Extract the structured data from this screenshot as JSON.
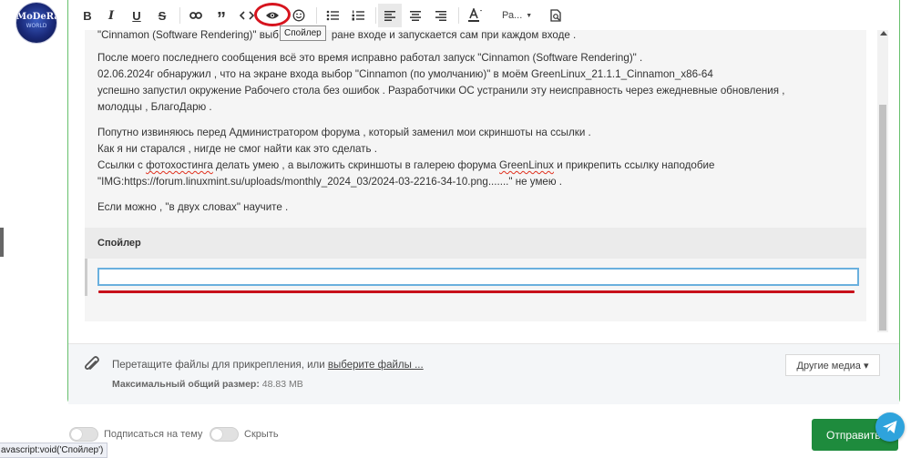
{
  "avatar": {
    "logo_text": "MoDeRa",
    "logo_sub": "WORLD"
  },
  "toolbar": {
    "bold": "B",
    "italic": "I",
    "underline": "U",
    "strike": "S",
    "quote": "”",
    "font_label": "Ра..."
  },
  "tooltip": {
    "spoiler": "Спойлер"
  },
  "post": {
    "lines": [
      [
        "\"Cinnamon (Software Rendering)\" выб",
        "ране входе и запускается сам при каждом входе ."
      ],
      [
        "После моего последнего сообщения всё это время исправно работал запуск \"Cinnamon (Software Rendering)\" ."
      ],
      [
        "02.06.2024г обнаружил , что на экране входа выбор \"Cinnamon (по умолчанию)\" в моём GreenLinux_21.1.1_Cinnamon_x86-64"
      ],
      [
        "успешно запустил окружение Рабочего стола без ошибок . Разработчики ОС устранили эту неисправность через ежедневные обновления ,"
      ],
      [
        "молодцы , БлагоДарю ."
      ],
      [
        "Попутно извиняюсь перед Администратором форума , который заменил мои скриншоты на ссылки ."
      ],
      [
        "Как я ни старался , нигде не смог найти как это сделать ."
      ],
      [
        "Ссылки с ",
        "фотохостинга",
        " делать умею , а выложить скриншоты в галерею форума ",
        "GreenLinux",
        " и прикрепить ссылку наподобие"
      ],
      [
        "\"IMG:https://forum.linuxmint.su/uploads/monthly_2024_03/2024-03-2216-34-10.png.......\" не умею ."
      ],
      [
        "Если можно , \"в двух словах\" научите ."
      ]
    ]
  },
  "spoiler": {
    "title": "Спойлер"
  },
  "attachments": {
    "drop_text": "Перетащите файлы для прикрепления, или ",
    "choose_link": "выберите файлы ...",
    "max_label": "Максимальный общий размер:",
    "max_value": "48.83 MB",
    "other_media": "Другие медиа ▾"
  },
  "options": {
    "subscribe": "Подписаться на тему",
    "hide": "Скрыть"
  },
  "status": {
    "url": "avascript:void('Спойлер')"
  },
  "submit": {
    "label": "Отправить"
  },
  "colors": {
    "accent_green": "#1e8b3d",
    "highlight_red": "#d6141e",
    "telegram_blue": "#2ea3dc"
  }
}
